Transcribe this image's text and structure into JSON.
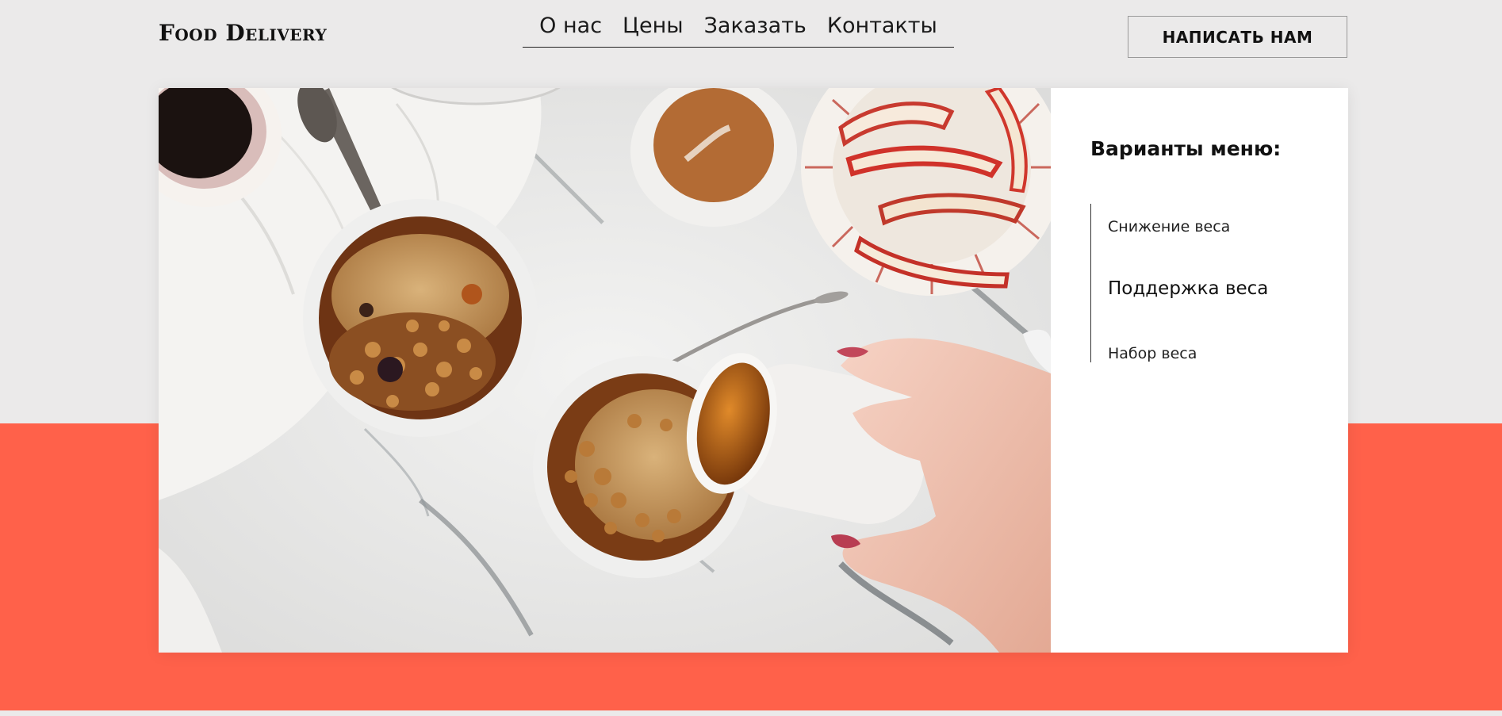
{
  "header": {
    "logo": "Food Delivery",
    "nav": [
      {
        "label": "О нас"
      },
      {
        "label": "Цены"
      },
      {
        "label": "Заказать"
      },
      {
        "label": "Контакты"
      }
    ],
    "cta_label": "НАПИСАТЬ НАМ"
  },
  "hero": {
    "menu_title": "Варианты меню:",
    "menu_items": [
      {
        "label": "Снижение веса"
      },
      {
        "label": "Поддержка веса"
      },
      {
        "label": "Набор веса"
      }
    ]
  },
  "colors": {
    "background": "#ebeaea",
    "accent": "#ff614a",
    "panel": "#ffffff",
    "text": "#111111"
  }
}
